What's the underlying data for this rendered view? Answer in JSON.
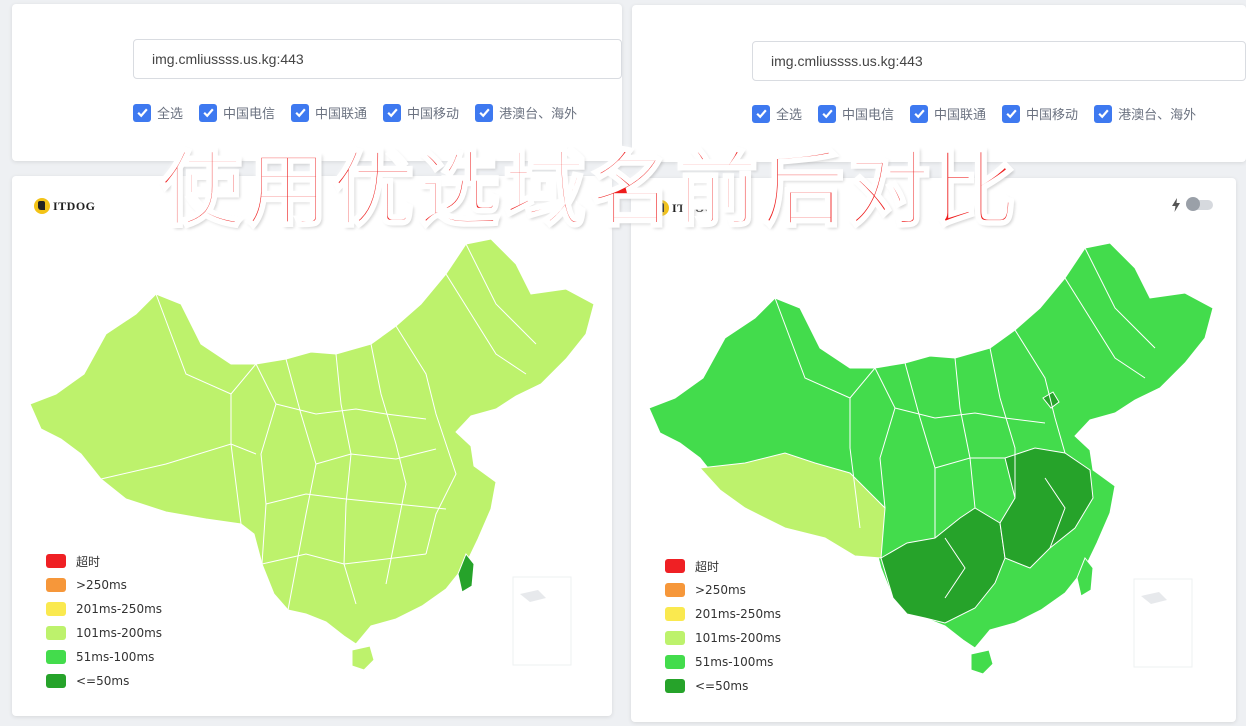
{
  "headline": "使用优选域名前后对比",
  "panels": [
    {
      "domain_value": "img.cmliussss.us.kg:443",
      "checkboxes": [
        "全选",
        "中国电信",
        "中国联通",
        "中国移动",
        "港澳台、海外"
      ],
      "logo_text": "ITDOG",
      "map_fill": "#bdf26c"
    },
    {
      "domain_value": "img.cmliussss.us.kg:443",
      "checkboxes": [
        "全选",
        "中国电信",
        "中国联通",
        "中国移动",
        "港澳台、海外"
      ],
      "logo_text": "ITDOG",
      "map_fill": "#43dc4c",
      "map_fill_dark": "#26a32a",
      "tibet_fill": "#bdf26c"
    }
  ],
  "legend": [
    {
      "label": "超时",
      "color": "#ef2024"
    },
    {
      "label": ">250ms",
      "color": "#f6973a"
    },
    {
      "label": "201ms-250ms",
      "color": "#fae94f"
    },
    {
      "label": "101ms-200ms",
      "color": "#bdf26c"
    },
    {
      "label": "51ms-100ms",
      "color": "#43dc4c"
    },
    {
      "label": "<=50ms",
      "color": "#26a32a"
    }
  ],
  "colors": {
    "checkbox": "#3e79f0",
    "headline": "#ee1c1c"
  }
}
